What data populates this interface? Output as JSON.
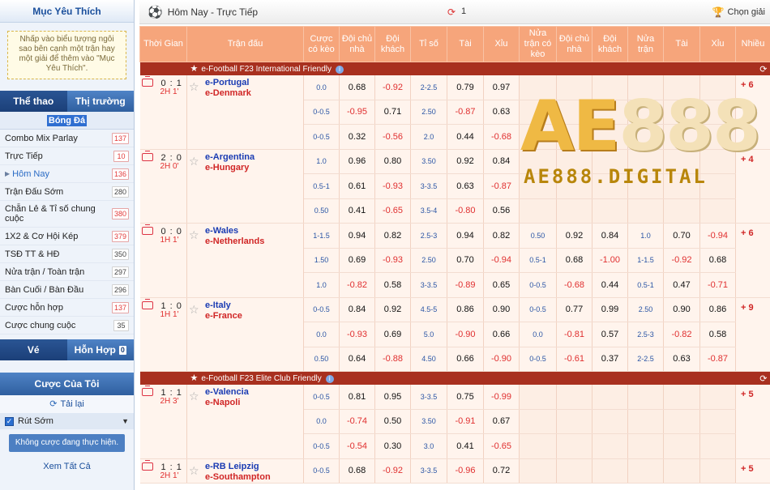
{
  "sidebar": {
    "title": "Mục Yêu Thích",
    "fav_note": "Nhấp vào biểu tượng ngôi sao bên cạnh một trận hay một giải để thêm vào \"Mục Yêu Thích\".",
    "tabs": [
      "Thể thao",
      "Thị trường"
    ],
    "sport_title": "Bóng Đá",
    "menu": [
      {
        "label": "Combo Mix Parlay",
        "count": "137",
        "red": true
      },
      {
        "label": "Trực Tiếp",
        "count": "10",
        "red": true
      },
      {
        "label": "Hôm Nay",
        "count": "136",
        "red": true,
        "selected": true
      },
      {
        "label": "Trận Đấu Sớm",
        "count": "280",
        "red": false
      },
      {
        "label": "Chẵn Lẻ & Tỉ số chung cuộc",
        "count": "380",
        "red": true
      },
      {
        "label": "1X2 & Cơ Hội Kép",
        "count": "379",
        "red": true
      },
      {
        "label": "TSĐ TT & HĐ",
        "count": "350",
        "red": false
      },
      {
        "label": "Nửa trận / Toàn trận",
        "count": "297",
        "red": false
      },
      {
        "label": "Bàn Cuối / Bàn Đầu",
        "count": "296",
        "red": false
      },
      {
        "label": "Cược hỗn hợp",
        "count": "137",
        "red": true
      },
      {
        "label": "Cược chung cuộc",
        "count": "35",
        "red": false
      }
    ],
    "tabs2": [
      "Vé",
      "Hỗn Hợp"
    ],
    "tabs2_badge": "0",
    "bets_title": "Cược Của Tôi",
    "reload": "Tải lại",
    "cashout": "Rút Sớm",
    "no_bet": "Không cược đang thực hiện.",
    "see_all": "Xem Tất Cả"
  },
  "topbar": {
    "title": "Hôm Nay - Trực Tiếp",
    "refresh_count": "1",
    "choose_league": "Chọn giải"
  },
  "columns": [
    "Thời Gian",
    "Trận đấu",
    "Cược có kèo",
    "Đội chủ nhà",
    "Đội khách",
    "Tỉ số",
    "Tài",
    "Xỉu",
    "Nửa trận có kèo",
    "Đội chủ nhà",
    "Đội khách",
    "Nửa trận",
    "Tài",
    "Xỉu",
    "Nhiều"
  ],
  "watermark": {
    "big_a": "AE",
    "big_b": "888",
    "small": "AE888.DIGITAL"
  },
  "leagues": [
    {
      "name": "e-Football F23 International Friendly",
      "matches": [
        {
          "score": "0 : 1",
          "live": "2H 1'",
          "home": "e-Portugal",
          "away": "e-Denmark",
          "more": "+ 6",
          "rows": [
            [
              "0.0",
              "0.68",
              "-0.92",
              "2-2.5",
              "0.79",
              "0.97",
              "",
              "",
              "",
              "",
              "",
              ""
            ],
            [
              "0-0.5",
              "-0.95",
              "0.71",
              "2.50",
              "-0.87",
              "0.63",
              "",
              "",
              "",
              "",
              "",
              ""
            ],
            [
              "0-0.5",
              "0.32",
              "-0.56",
              "2.0",
              "0.44",
              "-0.68",
              "",
              "",
              "",
              "",
              "",
              ""
            ]
          ]
        },
        {
          "score": "2 : 0",
          "live": "2H 0'",
          "home": "e-Argentina",
          "away": "e-Hungary",
          "more": "+ 4",
          "rows": [
            [
              "1.0",
              "0.96",
              "0.80",
              "3.50",
              "0.92",
              "0.84",
              "",
              "",
              "",
              "",
              "",
              ""
            ],
            [
              "0.5-1",
              "0.61",
              "-0.93",
              "3-3.5",
              "0.63",
              "-0.87",
              "",
              "",
              "",
              "",
              "",
              ""
            ],
            [
              "0.50",
              "0.41",
              "-0.65",
              "3.5-4",
              "-0.80",
              "0.56",
              "",
              "",
              "",
              "",
              "",
              ""
            ]
          ]
        },
        {
          "score": "0 : 0",
          "live": "1H 1'",
          "home": "e-Wales",
          "away": "e-Netherlands",
          "more": "+ 6",
          "rows": [
            [
              "1-1.5",
              "0.94",
              "0.82",
              "2.5-3",
              "0.94",
              "0.82",
              "0.50",
              "0.92",
              "0.84",
              "1.0",
              "0.70",
              "-0.94"
            ],
            [
              "1.50",
              "0.69",
              "-0.93",
              "2.50",
              "0.70",
              "-0.94",
              "0.5-1",
              "0.68",
              "-1.00",
              "1-1.5",
              "-0.92",
              "0.68"
            ],
            [
              "1.0",
              "-0.82",
              "0.58",
              "3-3.5",
              "-0.89",
              "0.65",
              "0-0.5",
              "-0.68",
              "0.44",
              "0.5-1",
              "0.47",
              "-0.71"
            ]
          ]
        },
        {
          "score": "1 : 0",
          "live": "1H 1'",
          "home": "e-Italy",
          "away": "e-France",
          "more": "+ 9",
          "rows": [
            [
              "0-0.5",
              "0.84",
              "0.92",
              "4.5-5",
              "0.86",
              "0.90",
              "0-0.5",
              "0.77",
              "0.99",
              "2.50",
              "0.90",
              "0.86"
            ],
            [
              "0.0",
              "-0.93",
              "0.69",
              "5.0",
              "-0.90",
              "0.66",
              "0.0",
              "-0.81",
              "0.57",
              "2.5-3",
              "-0.82",
              "0.58"
            ],
            [
              "0.50",
              "0.64",
              "-0.88",
              "4.50",
              "0.66",
              "-0.90",
              "0-0.5",
              "-0.61",
              "0.37",
              "2-2.5",
              "0.63",
              "-0.87"
            ]
          ]
        }
      ]
    },
    {
      "name": "e-Football F23 Elite Club Friendly",
      "matches": [
        {
          "score": "1 : 1",
          "live": "2H 3'",
          "home": "e-Valencia",
          "away": "e-Napoli",
          "more": "+ 5",
          "rows": [
            [
              "0-0.5",
              "0.81",
              "0.95",
              "3-3.5",
              "0.75",
              "-0.99",
              "",
              "",
              "",
              "",
              "",
              ""
            ],
            [
              "0.0",
              "-0.74",
              "0.50",
              "3.50",
              "-0.91",
              "0.67",
              "",
              "",
              "",
              "",
              "",
              ""
            ],
            [
              "0-0.5",
              "-0.54",
              "0.30",
              "3.0",
              "0.41",
              "-0.65",
              "",
              "",
              "",
              "",
              "",
              ""
            ]
          ]
        },
        {
          "score": "1 : 1",
          "live": "2H 1'",
          "home": "e-RB Leipzig",
          "away": "e-Southampton",
          "more": "+ 5",
          "rows": [
            [
              "0-0.5",
              "0.68",
              "-0.92",
              "3-3.5",
              "-0.96",
              "0.72",
              "",
              "",
              "",
              "",
              "",
              ""
            ]
          ]
        }
      ]
    }
  ]
}
